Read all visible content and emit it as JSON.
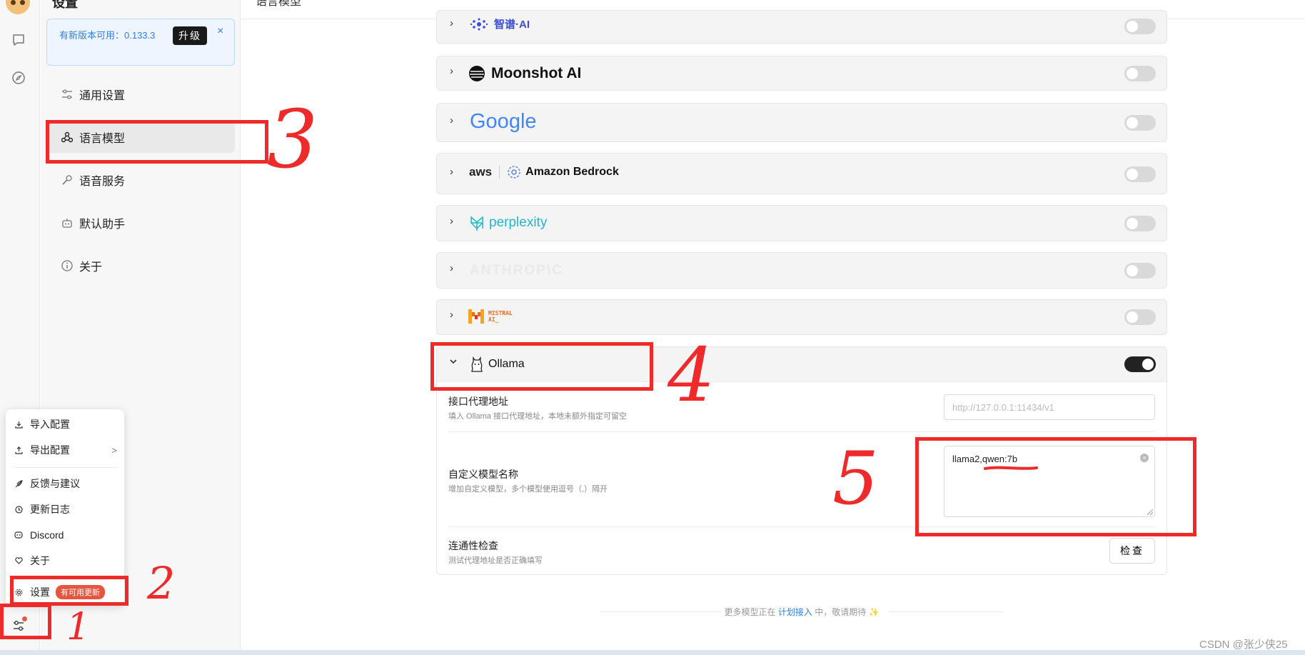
{
  "sidebar": {
    "title": "设置",
    "update_text": "有新版本可用：0.133.3",
    "upgrade_label": "升级",
    "close_symbol": "×",
    "nav": [
      {
        "label": "通用设置"
      },
      {
        "label": "语言模型"
      },
      {
        "label": "语音服务"
      },
      {
        "label": "默认助手"
      },
      {
        "label": "关于"
      }
    ]
  },
  "header": {
    "title": "语言模型"
  },
  "popup_menu": {
    "items": [
      {
        "label": "导入配置"
      },
      {
        "label": "导出配置"
      },
      {
        "label": "反馈与建议"
      },
      {
        "label": "更新日志"
      },
      {
        "label": "Discord"
      },
      {
        "label": "关于"
      },
      {
        "label": "设置"
      }
    ],
    "chevron": ">",
    "badge": "有可用更新"
  },
  "providers": [
    {
      "name": "智谱·AI",
      "enabled": false
    },
    {
      "name": "Moonshot AI",
      "enabled": false
    },
    {
      "name": "Google",
      "enabled": false
    },
    {
      "name": "aws",
      "name2": "Amazon Bedrock",
      "enabled": false
    },
    {
      "name": "perplexity",
      "enabled": false
    },
    {
      "name": "ANTHROP\\C",
      "enabled": false
    },
    {
      "name": "MISTRAL",
      "name2": "AI_",
      "enabled": false
    },
    {
      "name": "Ollama",
      "enabled": true
    }
  ],
  "ollama": {
    "proxy_label": "接口代理地址",
    "proxy_desc": "填入 Ollama 接口代理地址，本地未额外指定可留空",
    "proxy_placeholder": "http://127.0.0.1:11434/v1",
    "custom_label": "自定义模型名称",
    "custom_desc": "增加自定义模型，多个模型使用逗号（,）隔开",
    "custom_value": "llama2,qwen:7b",
    "check_label": "连通性检查",
    "check_desc": "测试代理地址是否正确填写",
    "check_button": "检查"
  },
  "footer": {
    "prefix": "更多模型正在",
    "link": "计划接入",
    "suffix": "中，敬请期待 ✨"
  },
  "watermark": "CSDN @张少侠25",
  "annotations": [
    "1",
    "2",
    "3",
    "4",
    "5"
  ],
  "colors": {
    "annotation": "#ee2a2a",
    "accent": "#2f7fe0",
    "badge": "#e8553e"
  }
}
